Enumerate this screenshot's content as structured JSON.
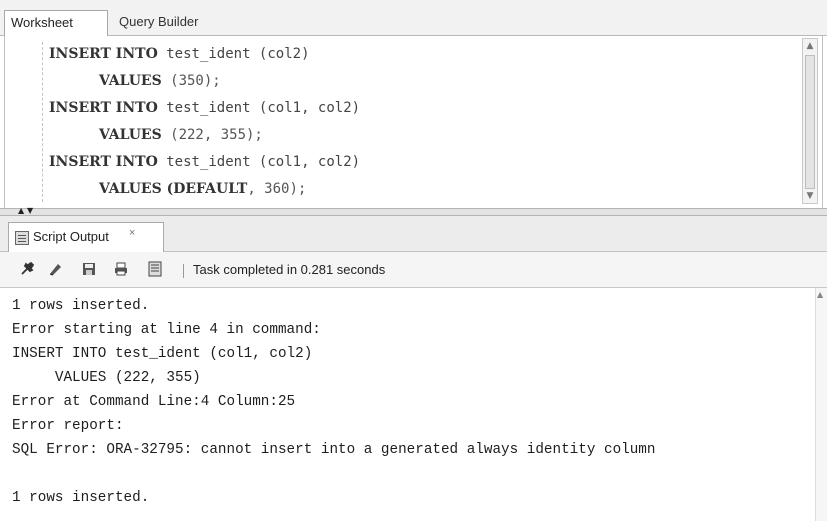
{
  "worksheet": {
    "tabs": [
      {
        "label": "Worksheet"
      },
      {
        "label": "Query Builder"
      }
    ],
    "code": [
      {
        "kw": "INSERT INTO",
        "rest": " test_ident (col2)"
      },
      {
        "kw": "VALUES",
        "rest": " (350);"
      },
      {
        "kw": "INSERT INTO",
        "rest": " test_ident (col1, col2)"
      },
      {
        "kw": "VALUES",
        "rest": " (222, 355);"
      },
      {
        "kw": "INSERT INTO",
        "rest": " test_ident (col1, col2)"
      },
      {
        "kw": "VALUES (DEFAULT",
        "rest": ", 360);"
      }
    ]
  },
  "script_output": {
    "tab_label": "Script Output",
    "tab_close": "×",
    "toolbar": {
      "icons": [
        "pin-icon",
        "eraser-icon",
        "save-icon",
        "print-icon",
        "document-icon"
      ],
      "status": "Task completed in 0.281 seconds"
    },
    "lines": [
      "1 rows inserted.",
      "Error starting at line 4 in command:",
      "INSERT INTO test_ident (col1, col2)",
      "     VALUES (222, 355)",
      "Error at Command Line:4 Column:25",
      "Error report:",
      "SQL Error: ORA-32795: cannot insert into a generated always identity column",
      "",
      "1 rows inserted."
    ]
  }
}
